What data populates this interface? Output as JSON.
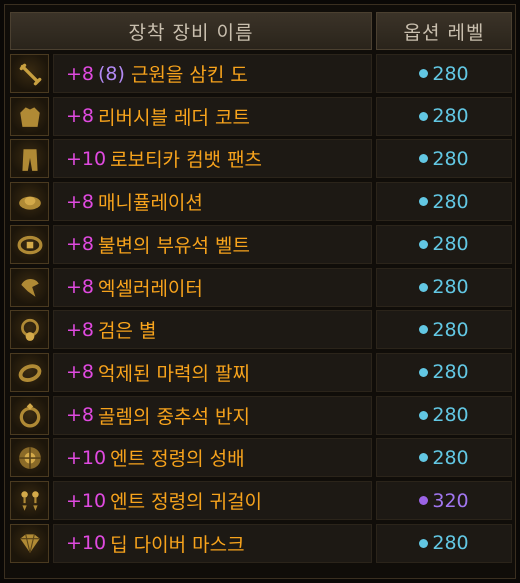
{
  "header": {
    "name_label": "장착 장비 이름",
    "level_label": "옵션 레벨"
  },
  "items": [
    {
      "plus": "+8",
      "paren": "(8)",
      "name": "근원을 삼킨 도",
      "icon": "sword-icon",
      "level": "280",
      "tier": "cyan"
    },
    {
      "plus": "+8",
      "paren": "",
      "name": "리버시블 레더 코트",
      "icon": "coat-icon",
      "level": "280",
      "tier": "cyan"
    },
    {
      "plus": "+10",
      "paren": "",
      "name": "로보티카 컴뱃 팬츠",
      "icon": "pants-icon",
      "level": "280",
      "tier": "cyan"
    },
    {
      "plus": "+8",
      "paren": "",
      "name": "매니퓰레이션",
      "icon": "shoulder-icon",
      "level": "280",
      "tier": "cyan"
    },
    {
      "plus": "+8",
      "paren": "",
      "name": "불변의 부유석 벨트",
      "icon": "belt-icon",
      "level": "280",
      "tier": "cyan"
    },
    {
      "plus": "+8",
      "paren": "",
      "name": "엑셀러레이터",
      "icon": "bracelet-icon",
      "level": "280",
      "tier": "cyan"
    },
    {
      "plus": "+8",
      "paren": "",
      "name": "검은 별",
      "icon": "necklace-icon",
      "level": "280",
      "tier": "cyan"
    },
    {
      "plus": "+8",
      "paren": "",
      "name": "억제된 마력의 팔찌",
      "icon": "armband-icon",
      "level": "280",
      "tier": "cyan"
    },
    {
      "plus": "+8",
      "paren": "",
      "name": "골렘의 중추석 반지",
      "icon": "ring-icon",
      "level": "280",
      "tier": "cyan"
    },
    {
      "plus": "+10",
      "paren": "",
      "name": "엔트 정령의 성배",
      "icon": "chalice-icon",
      "level": "280",
      "tier": "cyan"
    },
    {
      "plus": "+10",
      "paren": "",
      "name": "엔트 정령의 귀걸이",
      "icon": "earring-icon",
      "level": "320",
      "tier": "purple"
    },
    {
      "plus": "+10",
      "paren": "",
      "name": "딥 다이버 마스크",
      "icon": "mask-icon",
      "level": "280",
      "tier": "cyan"
    }
  ],
  "colors": {
    "plus": "#e04ae0",
    "item_name": "#f7a31c",
    "level_cyan": "#62c7e3",
    "level_purple": "#a176ef"
  }
}
